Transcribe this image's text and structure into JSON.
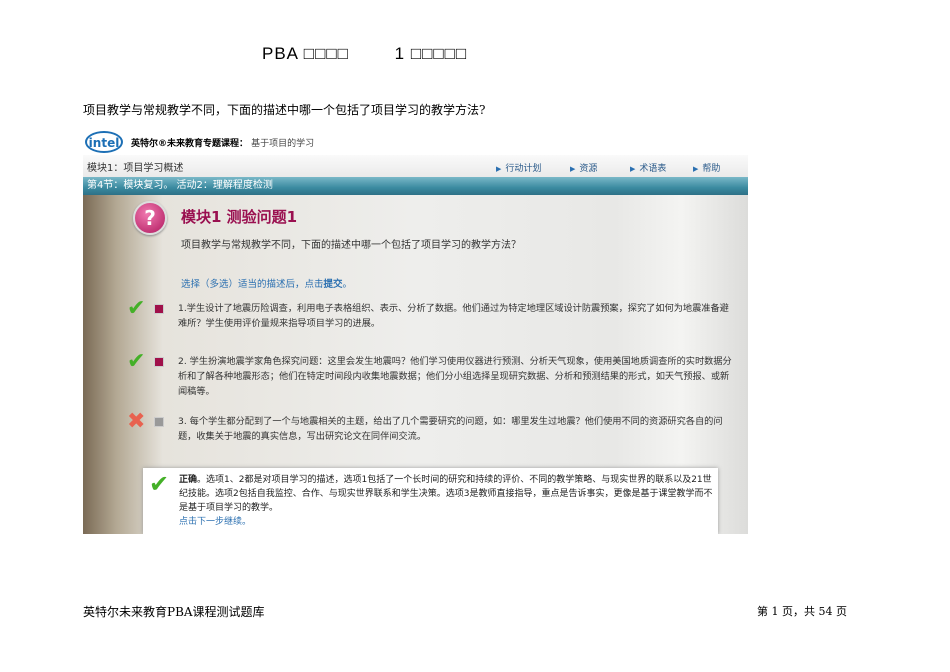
{
  "doc": {
    "title": "PBA □□□□        1 □□□□□",
    "question": "项目教学与常规教学不同，下面的描述中哪一个包括了项目学习的教学方法?",
    "footer_left": "英特尔未来教育PBA课程测试题库",
    "footer_right": "第 1 页，共 54 页"
  },
  "screenshot": {
    "logo": "intel",
    "course_label": "英特尔®未来教育专题课程：",
    "course_name": "基于项目的学习",
    "module": "模块1：项目学习概述",
    "nav": [
      "行动计划",
      "资源",
      "术语表",
      "帮助"
    ],
    "section": "第4节：模块复习。 活动2：理解程度检测",
    "quiz_title": "模块1 测验问题1",
    "quiz_question": "项目教学与常规教学不同，下面的描述中哪一个包括了项目学习的教学方法？",
    "instruction_prefix": "选择（多选）适当的描述后，点击",
    "instruction_action": "提交",
    "instruction_suffix": "。",
    "options": [
      {
        "status": "correct",
        "text": "1.学生设计了地震历险调查，利用电子表格组织、表示、分析了数据。他们通过为特定地理区域设计防震预案，探究了如何为地震准备避难所？学生使用评价量规来指导项目学习的进展。"
      },
      {
        "status": "correct",
        "text": "2. 学生扮演地震学家角色探究问题：这里会发生地震吗？他们学习使用仪器进行预测、分析天气现象，使用美国地质调查所的实时数据分析和了解各种地震形态；他们在特定时间段内收集地震数据；他们分小组选择呈现研究数据、分析和预测结果的形式，如天气预报、或新闻稿等。"
      },
      {
        "status": "incorrect",
        "text": "3. 每个学生都分配到了一个与地震相关的主题，给出了几个需要研究的问题，如：哪里发生过地震？他们使用不同的资源研究各自的问题，收集关于地震的真实信息，写出研究论文在同伴间交流。"
      }
    ],
    "feedback_label": "正确",
    "feedback_text": "。选项1、2都是对项目学习的描述，选项1包括了一个长时间的研究和持续的评价、不同的教学策略、与现实世界的联系以及21世纪技能。选项2包括自我监控、合作、与现实世界联系和学生决策。选项3是教师直接指导，重点是告诉事实，更像是基于课堂教学而不是基于项目学习的教学。",
    "feedback_link": "点击下一步继续。"
  }
}
